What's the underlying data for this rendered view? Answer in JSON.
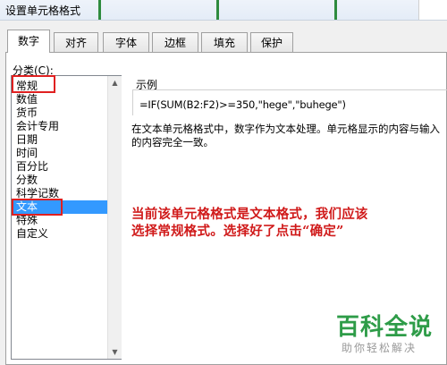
{
  "dialog": {
    "title": "设置单元格格式"
  },
  "tabs": [
    {
      "label": "数字",
      "active": true
    },
    {
      "label": "对齐",
      "active": false
    },
    {
      "label": "字体",
      "active": false
    },
    {
      "label": "边框",
      "active": false
    },
    {
      "label": "填充",
      "active": false
    },
    {
      "label": "保护",
      "active": false
    }
  ],
  "category": {
    "label": "分类(C):",
    "items": [
      "常规",
      "数值",
      "货币",
      "会计专用",
      "日期",
      "时间",
      "百分比",
      "分数",
      "科学记数",
      "文本",
      "特殊",
      "自定义"
    ],
    "selected": "文本"
  },
  "sample": {
    "label": "示例",
    "value": "=IF(SUM(B2:F2)>=350,\"hege\",\"buhege\")"
  },
  "description": "在文本单元格格式中，数字作为文本处理。单元格显示的内容与输入的内容完全一致。",
  "annotation": {
    "line1": "当前该单元格格式是文本格式，我们应该",
    "line2": "选择常规格式。选择好了点击“确定”"
  },
  "watermark": {
    "title": "百科全说",
    "subtitle": "助你轻松解决"
  },
  "colors": {
    "selection": "#3399ff",
    "annotation": "#d01a1a",
    "watermark": "#2e9c48",
    "highlight": "#e02020"
  }
}
